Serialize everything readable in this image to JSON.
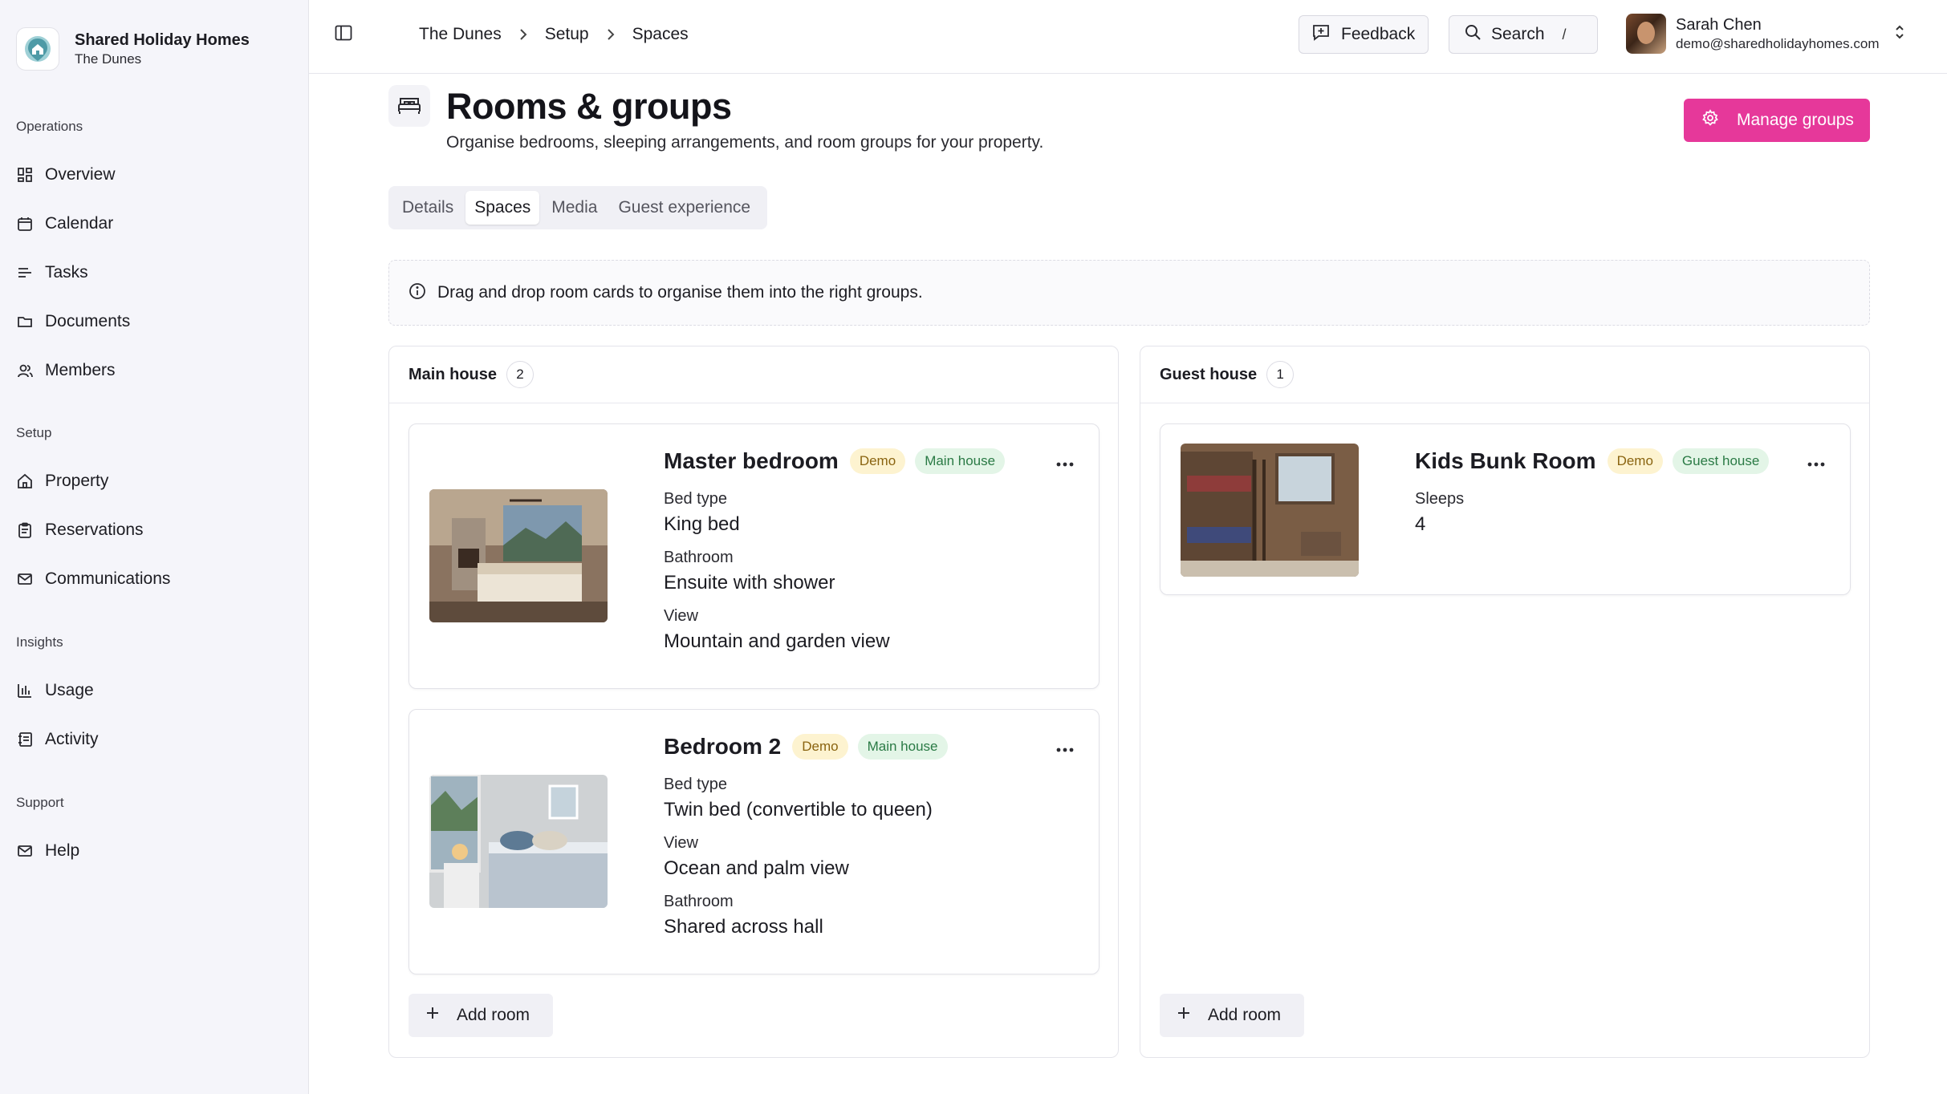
{
  "brand": {
    "name": "Shared Holiday Homes",
    "property": "The Dunes"
  },
  "nav": {
    "operations": {
      "heading": "Operations",
      "items": [
        {
          "label": "Overview",
          "icon": "dashboard-icon"
        },
        {
          "label": "Calendar",
          "icon": "calendar-icon"
        },
        {
          "label": "Tasks",
          "icon": "list-icon"
        },
        {
          "label": "Documents",
          "icon": "folder-icon"
        },
        {
          "label": "Members",
          "icon": "users-icon"
        }
      ]
    },
    "setup": {
      "heading": "Setup",
      "items": [
        {
          "label": "Property",
          "icon": "home-icon"
        },
        {
          "label": "Reservations",
          "icon": "clipboard-icon"
        },
        {
          "label": "Communications",
          "icon": "mail-icon"
        }
      ]
    },
    "insights": {
      "heading": "Insights",
      "items": [
        {
          "label": "Usage",
          "icon": "bar-chart-icon"
        },
        {
          "label": "Activity",
          "icon": "activity-log-icon"
        }
      ]
    },
    "support": {
      "heading": "Support",
      "items": [
        {
          "label": "Help",
          "icon": "mail-icon"
        }
      ]
    }
  },
  "topbar": {
    "breadcrumbs": [
      "The Dunes",
      "Setup",
      "Spaces"
    ],
    "feedback_label": "Feedback",
    "search_label": "Search",
    "search_shortcut": "/",
    "user": {
      "name": "Sarah Chen",
      "email": "demo@sharedholidayhomes.com"
    }
  },
  "page": {
    "title": "Rooms & groups",
    "subtitle": "Organise bedrooms, sleeping arrangements, and room groups for your property.",
    "manage_groups_label": "Manage groups",
    "tabs": [
      "Details",
      "Spaces",
      "Media",
      "Guest experience"
    ],
    "active_tab": "Spaces",
    "info_text": "Drag and drop room cards to organise them into the right groups."
  },
  "groups": [
    {
      "name": "Main house",
      "count": "2",
      "add_label": "Add room",
      "rooms": [
        {
          "title": "Master bedroom",
          "badge_demo": "Demo",
          "badge_group": "Main house",
          "attrs": [
            {
              "label": "Bed type",
              "value": "King bed"
            },
            {
              "label": "Bathroom",
              "value": "Ensuite with shower"
            },
            {
              "label": "View",
              "value": "Mountain and garden view"
            }
          ]
        },
        {
          "title": "Bedroom 2",
          "badge_demo": "Demo",
          "badge_group": "Main house",
          "attrs": [
            {
              "label": "Bed type",
              "value": "Twin bed (convertible to queen)"
            },
            {
              "label": "View",
              "value": "Ocean and palm view"
            },
            {
              "label": "Bathroom",
              "value": "Shared across hall"
            }
          ]
        }
      ]
    },
    {
      "name": "Guest house",
      "count": "1",
      "add_label": "Add room",
      "rooms": [
        {
          "title": "Kids Bunk Room",
          "badge_demo": "Demo",
          "badge_group": "Guest house",
          "attrs": [
            {
              "label": "Sleeps",
              "value": "4"
            }
          ]
        }
      ]
    }
  ],
  "colors": {
    "accent": "#e6389a",
    "demo_badge_bg": "#fdf3d0",
    "group_badge_bg": "#e3f5e7"
  }
}
